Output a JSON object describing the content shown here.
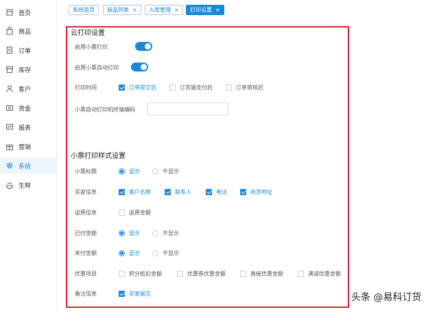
{
  "sidebar": {
    "items": [
      {
        "label": "首页",
        "icon": "home-icon"
      },
      {
        "label": "商品",
        "icon": "bag-icon"
      },
      {
        "label": "订单",
        "icon": "document-icon"
      },
      {
        "label": "库存",
        "icon": "box-icon"
      },
      {
        "label": "客户",
        "icon": "user-icon"
      },
      {
        "label": "资金",
        "icon": "money-icon"
      },
      {
        "label": "报表",
        "icon": "chart-icon"
      },
      {
        "label": "营销",
        "icon": "gift-icon"
      },
      {
        "label": "系统",
        "icon": "gear-icon",
        "active": true
      },
      {
        "label": "生鲜",
        "icon": "fresh-icon"
      }
    ]
  },
  "tabs": [
    {
      "label": "系统首页",
      "closable": false
    },
    {
      "label": "商品列表",
      "closable": true
    },
    {
      "label": "入库管理",
      "closable": true
    },
    {
      "label": "打印设置",
      "closable": true,
      "active": true
    }
  ],
  "cloud_print": {
    "title": "云打印设置",
    "enable_print_label": "启用小票打印",
    "auto_print_label": "启用小票自动打印",
    "print_time_label": "打印时间",
    "print_time_options": [
      {
        "label": "订单提交后",
        "checked": true
      },
      {
        "label": "订货端支付后",
        "checked": false
      },
      {
        "label": "订单审核后",
        "checked": false
      }
    ],
    "terminal_code_label": "小票自动打印机终端编码",
    "terminal_code_value": ""
  },
  "style": {
    "title": "小票打印样式设置",
    "ticket_title_label": "小票标题",
    "buyer_info_label": "买家信息",
    "buyer_info_options": [
      {
        "label": "客户名称",
        "checked": true
      },
      {
        "label": "联系人",
        "checked": true
      },
      {
        "label": "电话",
        "checked": true
      },
      {
        "label": "收货地址",
        "checked": true
      }
    ],
    "freight_label": "运费信息",
    "freight_option": "运费金额",
    "paid_label": "已付金额",
    "unpaid_label": "未付金额",
    "discount_label": "优惠项目",
    "discount_options": [
      {
        "label": "积分抵扣金额",
        "checked": false
      },
      {
        "label": "优惠券优惠金额",
        "checked": false
      },
      {
        "label": "直接优惠金额",
        "checked": false
      },
      {
        "label": "满减优惠金额",
        "checked": false
      }
    ],
    "remark_label": "备注信息",
    "remark_option": "买家留言",
    "show": "显示",
    "hide": "不显示"
  },
  "watermark": "头条 @易科订货",
  "colors": {
    "accent": "#1a88d6",
    "highlight_border": "#d9232d"
  }
}
